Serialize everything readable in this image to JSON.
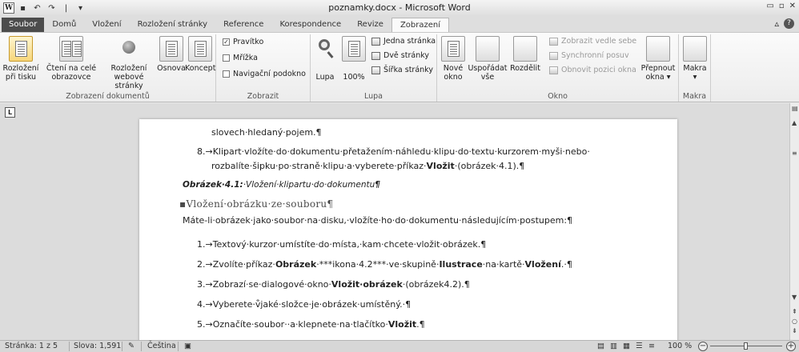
{
  "window": {
    "title": "poznamky.docx - Microsoft Word",
    "quick_access": [
      "W",
      "💾",
      "↶",
      "↷",
      "|",
      "▾"
    ],
    "controls": [
      "▭",
      "▫",
      "✕"
    ]
  },
  "tabs": [
    "Soubor",
    "Domů",
    "Vložení",
    "Rozložení stránky",
    "Reference",
    "Korespondence",
    "Revize",
    "Zobrazení"
  ],
  "ribbon": {
    "views_group": {
      "label": "Zobrazení dokumentů",
      "buttons": [
        {
          "label1": "Rozložení",
          "label2": "při tisku"
        },
        {
          "label1": "Čtení na celé",
          "label2": "obrazovce"
        },
        {
          "label1": "Rozložení",
          "label2": "webové stránky"
        },
        {
          "label1": "Osnova",
          "label2": ""
        },
        {
          "label1": "Koncept",
          "label2": ""
        }
      ]
    },
    "show_group": {
      "label": "Zobrazit",
      "items": [
        {
          "label": "Pravítko",
          "checked": true
        },
        {
          "label": "Mřížka",
          "checked": false
        },
        {
          "label": "Navigační podokno",
          "checked": false
        }
      ]
    },
    "zoom_group": {
      "label": "Lupa",
      "lupa": "Lupa",
      "percent": "100%",
      "small": [
        "Jedna stránka",
        "Dvě stránky",
        "Šířka stránky"
      ]
    },
    "window_group": {
      "label": "Okno",
      "new_window": [
        "Nové",
        "okno"
      ],
      "arrange": [
        "Uspořádat",
        "vše"
      ],
      "split": "Rozdělit",
      "small": [
        "Zobrazit vedle sebe",
        "Synchronní posuv",
        "Obnovit pozici okna"
      ],
      "switch": [
        "Přepnout",
        "okna ▾"
      ]
    },
    "macros_group": {
      "label": "Makra",
      "button": [
        "Makra",
        "▾"
      ]
    }
  },
  "document": {
    "lines": {
      "l1": "slovech·hledaný·pojem.¶",
      "l2a": "8.→Klipart·vložíte·do·dokumentu·přetažením·náhledu·klipu·do·textu·kurzorem·myši·nebo·",
      "l2b_pre": "rozbalíte·šipku·po·straně·klipu·a·vyberete·příkaz·",
      "l2b_bold": "Vložit",
      "l2b_post": "·(obrázek·4.1).¶",
      "cap_bold": "Obrázek·4.1:",
      "cap_rest": "·Vložení·klipartu·do·dokumentu",
      "cap_end": "¶",
      "heading": "Vložení·obrázku·ze·souboru¶",
      "intro": "Máte-li·obrázek·jako·soubor·na·disku,·vložíte·ho·do·dokumentu·následujícím·postupem:¶",
      "s1": "1.→Textový·kurzor·umístíte·do·místa,·kam·chcete·vložit·obrázek.¶",
      "s2_pre": "2.→Zvolíte·příkaz·",
      "s2_b1": "Obrázek",
      "s2_mid": "·***ikona·4.2***·ve·skupině·",
      "s2_b2": "Ilustrace",
      "s2_mid2": "·na·kartě·",
      "s2_b3": "Vložení",
      "s2_end": ".·¶",
      "s3_pre": "3.→Zobrazí·se·dialogové·okno·",
      "s3_b": "Vložit·obrázek",
      "s3_post": "·(obrázek4.2).¶",
      "s4": "4.→Vyberete·v͒jaké·složce·je·obrázek·umístěný.·¶",
      "s5_pre": "5.→Označíte·soubor··a·klepnete·na·tlačítko·",
      "s5_b": "Vložit",
      "s5_post": ".¶"
    }
  },
  "statusbar": {
    "page": "Stránka: 1 z 5",
    "words": "Slova: 1,591",
    "lang": "Čeština",
    "zoom": "100 %"
  }
}
